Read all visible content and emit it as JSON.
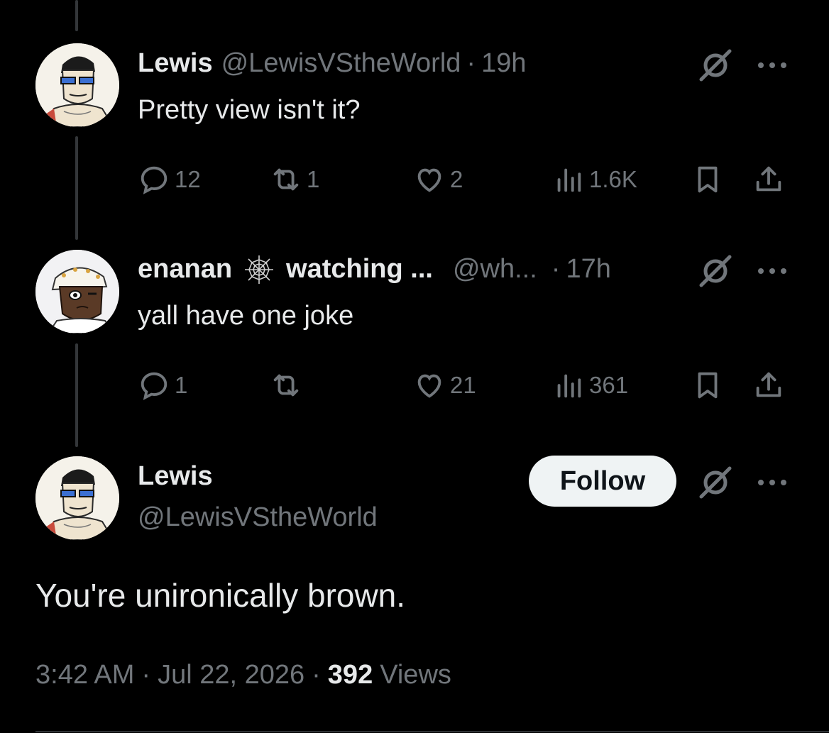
{
  "reply1": {
    "name": "Lewis",
    "handle": "@LewisVStheWorld",
    "sep": "·",
    "time": "19h",
    "text": "Pretty view isn't it?",
    "stats": {
      "replies": "12",
      "reposts": "1",
      "likes": "2",
      "views": "1.6K"
    }
  },
  "reply2": {
    "name": "enanan",
    "badge_icon": "spiderweb-icon",
    "name_suffix": "watching ...",
    "handle": "@wh...",
    "sep": "·",
    "time": "17h",
    "text": "yall have one joke",
    "stats": {
      "replies": "1",
      "reposts": "",
      "likes": "21",
      "views": "361"
    }
  },
  "main": {
    "name": "Lewis",
    "handle": "@LewisVStheWorld",
    "follow_label": "Follow",
    "text": "You're unironically brown.",
    "time": "3:42 AM",
    "sep": "·",
    "date": "Jul 22, 2026",
    "views_count": "392",
    "views_label": "Views"
  },
  "colors": {
    "background": "#000000",
    "text": "#e7e9ea",
    "muted": "#71767b",
    "follow_bg": "#eff3f4"
  }
}
